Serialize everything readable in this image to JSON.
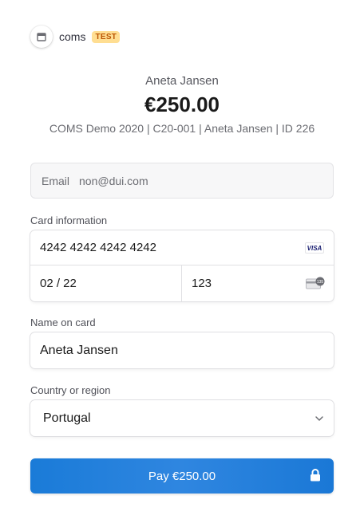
{
  "merchant": {
    "name": "coms",
    "test_badge": "TEST",
    "store_icon": "store-icon"
  },
  "summary": {
    "customer_name": "Aneta Jansen",
    "amount": "€250.00",
    "description": "COMS Demo 2020 | C20-001 | Aneta Jansen | ID 226"
  },
  "email": {
    "label": "Email",
    "value": "non@dui.com"
  },
  "card": {
    "label": "Card information",
    "number": "4242 4242 4242 4242",
    "brand_icon": "visa-card-icon",
    "brand_text": "VISA",
    "expiry": "02 / 22",
    "cvc": "123",
    "cvc_icon": "cvc-card-icon",
    "cvc_icon_text": "135"
  },
  "name_on_card": {
    "label": "Name on card",
    "value": "Aneta Jansen"
  },
  "country": {
    "label": "Country or region",
    "value": "Portugal",
    "icon": "chevron-down-icon"
  },
  "pay_button": {
    "label": "Pay €250.00",
    "icon": "lock-icon"
  },
  "colors": {
    "accent": "#1a7bd8",
    "test_badge_bg": "#ffde92",
    "test_badge_text": "#bb5504"
  }
}
